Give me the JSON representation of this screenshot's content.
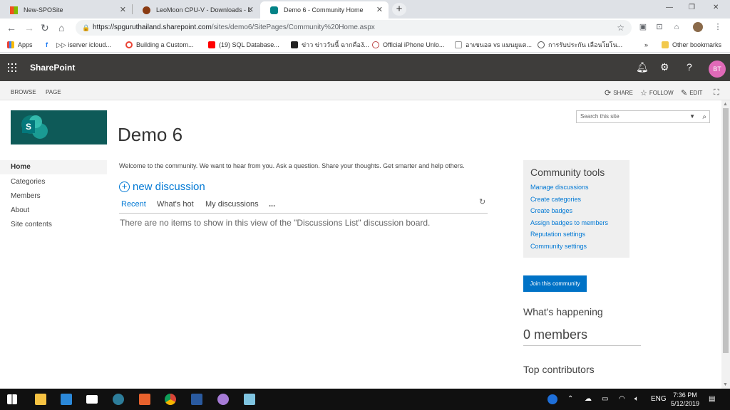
{
  "browser": {
    "tabs": [
      {
        "title": "New-SPOSite",
        "active": false
      },
      {
        "title": "LeoMoon CPU-V - Downloads - L",
        "active": false
      },
      {
        "title": "Demo 6 - Community Home",
        "active": true
      }
    ],
    "url_host": "https://spguruthailand.sharepoint.com",
    "url_path": "/sites/demo6/SitePages/Community%20Home.aspx",
    "bookmarks": [
      "Apps",
      "▷▷ iserver icloud...",
      "Building a Custom...",
      "(19) SQL Database...",
      "ข่าว ข่าววันนี้ ฉากคืองั...",
      "Official iPhone Unlo...",
      "อาเซนอล vs แมนยูแต...",
      "การรับประกัน เลือนโยโน..."
    ],
    "bookmarks_overflow": "»",
    "other_bookmarks": "Other bookmarks"
  },
  "suite": {
    "brand": "SharePoint",
    "avatar": "BT"
  },
  "ribbon": {
    "browse": "BROWSE",
    "page": "PAGE",
    "share": "SHARE",
    "follow": "FOLLOW",
    "edit": "EDIT"
  },
  "site": {
    "title": "Demo 6",
    "logo_letter": "S",
    "search_placeholder": "Search this site"
  },
  "nav": [
    "Home",
    "Categories",
    "Members",
    "About",
    "Site contents"
  ],
  "main": {
    "welcome": "Welcome to the community. We want to hear from you. Ask a question. Share your thoughts. Get smarter and help others.",
    "new_discussion": "new discussion",
    "views": [
      "Recent",
      "What's hot",
      "My discussions"
    ],
    "more": "...",
    "empty": "There are no items to show in this view of the \"Discussions List\" discussion board."
  },
  "tools": {
    "title": "Community tools",
    "links": [
      "Manage discussions",
      "Create categories",
      "Create badges",
      "Assign badges to members",
      "Reputation settings",
      "Community settings"
    ]
  },
  "join_label": "Join this community",
  "happening": "What's happening",
  "members": "0 members",
  "top_contributors": "Top contributors",
  "taskbar": {
    "lang": "ENG",
    "time": "7:36 PM",
    "date": "5/12/2019"
  }
}
